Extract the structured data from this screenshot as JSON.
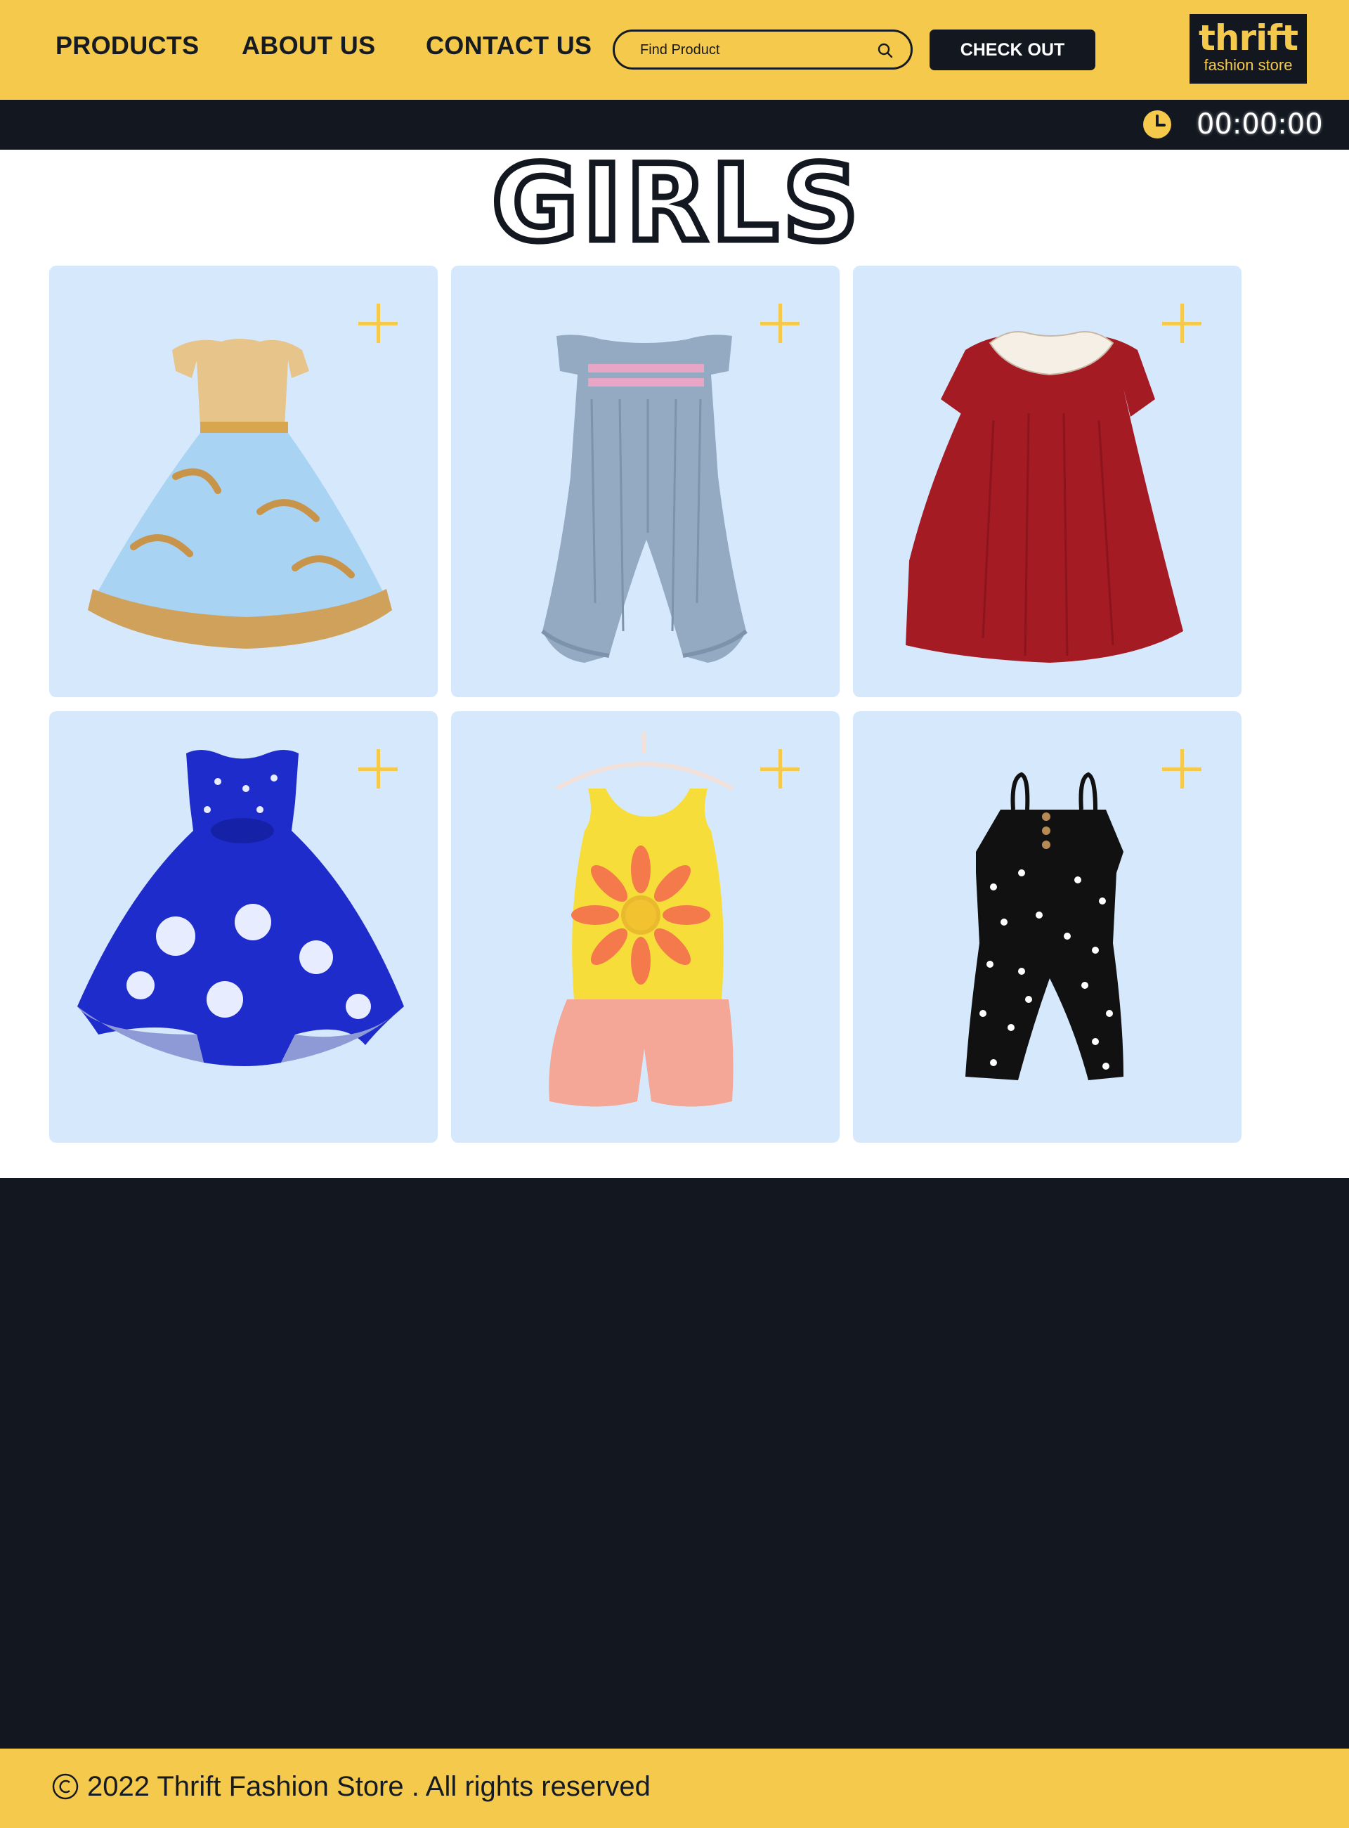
{
  "nav": {
    "products": "PRODUCTS",
    "about": "ABOUT US",
    "contact": "CONTACT US"
  },
  "search": {
    "placeholder": "Find Product",
    "icon": "search-icon"
  },
  "checkout_label": "CHECK OUT",
  "logo": {
    "main": "thrift",
    "sub": "fashion store"
  },
  "timer": {
    "icon": "clock-icon",
    "value": "00:00:00"
  },
  "section": {
    "title": "GIRLS"
  },
  "products": [
    {
      "item": "lace-party-dress",
      "add_icon": "plus-icon"
    },
    {
      "item": "smocked-romper",
      "add_icon": "plus-icon"
    },
    {
      "item": "red-velvet-dress",
      "add_icon": "plus-icon"
    },
    {
      "item": "blue-polka-dot-dress",
      "add_icon": "plus-icon"
    },
    {
      "item": "sunflower-top-and-shorts-set",
      "add_icon": "plus-icon"
    },
    {
      "item": "black-star-jumpsuit",
      "add_icon": "plus-icon"
    }
  ],
  "footer": {
    "icon": "copyright-icon",
    "text": "2022 Thrift Fashion Store . All rights reserved"
  },
  "colors": {
    "brand_yellow": "#f5c94c",
    "dark": "#131820",
    "card_bg": "#d6e9fc"
  }
}
